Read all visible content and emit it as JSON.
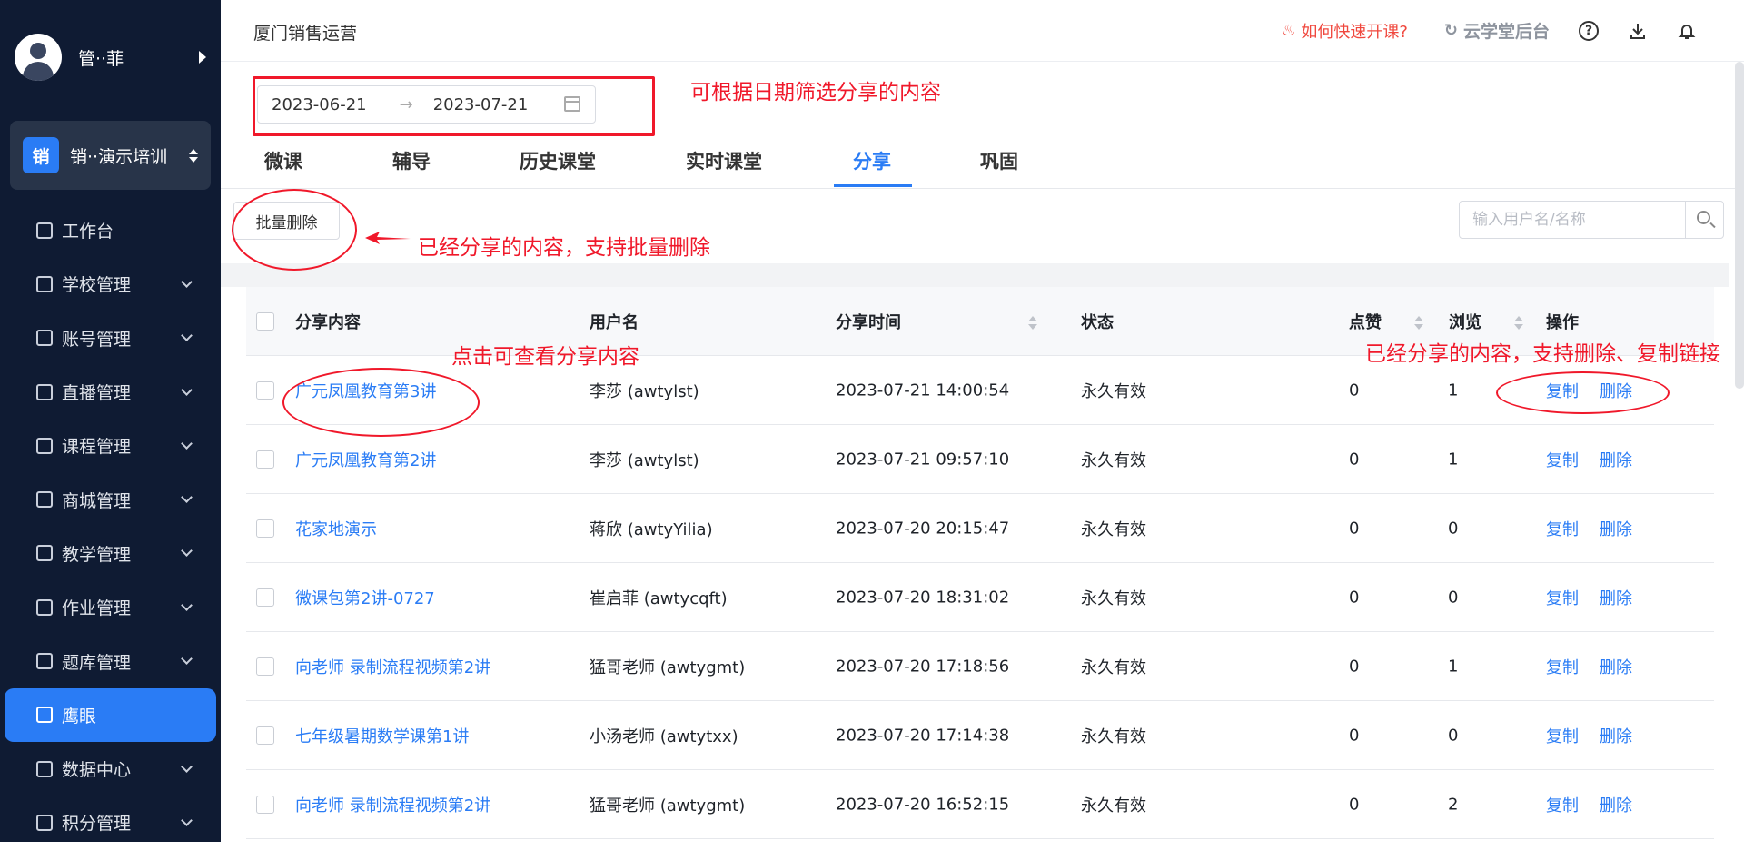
{
  "sidebar": {
    "user_name": "管··菲",
    "org_logo": "销",
    "org_name": "销··演示培训",
    "menu": [
      {
        "label": "工作台",
        "icon": "dashboard-icon",
        "chevron": false
      },
      {
        "label": "学校管理",
        "icon": "school-icon",
        "chevron": true
      },
      {
        "label": "账号管理",
        "icon": "user-icon",
        "chevron": true
      },
      {
        "label": "直播管理",
        "icon": "live-icon",
        "chevron": true
      },
      {
        "label": "课程管理",
        "icon": "course-icon",
        "chevron": true
      },
      {
        "label": "商城管理",
        "icon": "store-icon",
        "chevron": true
      },
      {
        "label": "教学管理",
        "icon": "teach-icon",
        "chevron": true
      },
      {
        "label": "作业管理",
        "icon": "homework-icon",
        "chevron": true
      },
      {
        "label": "题库管理",
        "icon": "question-bank-icon",
        "chevron": true
      },
      {
        "label": "鹰眼",
        "icon": "eagle-eye-icon",
        "chevron": false,
        "active": true
      },
      {
        "label": "数据中心",
        "icon": "data-center-icon",
        "chevron": true
      },
      {
        "label": "积分管理",
        "icon": "star-icon",
        "chevron": true
      }
    ]
  },
  "topbar": {
    "title": "厦门销售运营",
    "quick_start": "如何快速开课?",
    "cloud_admin": "云学堂后台"
  },
  "date_filter": {
    "start": "2023-06-21",
    "arrow": "→",
    "end": "2023-07-21"
  },
  "tabs": [
    "微课",
    "辅导",
    "历史课堂",
    "实时课堂",
    "分享",
    "巩固"
  ],
  "active_tab": "分享",
  "toolbar": {
    "batch_delete": "批量删除",
    "search_placeholder": "输入用户名/名称"
  },
  "table": {
    "headers": {
      "content": "分享内容",
      "user": "用户名",
      "time": "分享时间",
      "status": "状态",
      "likes": "点赞",
      "views": "浏览",
      "actions": "操作"
    },
    "copy_label": "复制",
    "delete_label": "删除",
    "rows": [
      {
        "content": "广元凤凰教育第3讲",
        "user": "李莎 (awtylst)",
        "time": "2023-07-21 14:00:54",
        "status": "永久有效",
        "likes": "0",
        "views": "1"
      },
      {
        "content": "广元凤凰教育第2讲",
        "user": "李莎 (awtylst)",
        "time": "2023-07-21 09:57:10",
        "status": "永久有效",
        "likes": "0",
        "views": "1"
      },
      {
        "content": "花家地演示",
        "user": "蒋欣 (awtyYilia)",
        "time": "2023-07-20 20:15:47",
        "status": "永久有效",
        "likes": "0",
        "views": "0"
      },
      {
        "content": "微课包第2讲-0727",
        "user": "崔启菲 (awtycqft)",
        "time": "2023-07-20 18:31:02",
        "status": "永久有效",
        "likes": "0",
        "views": "0"
      },
      {
        "content": "向老师 录制流程视频第2讲",
        "user": "猛哥老师 (awtygmt)",
        "time": "2023-07-20 17:18:56",
        "status": "永久有效",
        "likes": "0",
        "views": "1"
      },
      {
        "content": "七年级暑期数学课第1讲",
        "user": "小汤老师 (awtytxx)",
        "time": "2023-07-20 17:14:38",
        "status": "永久有效",
        "likes": "0",
        "views": "0"
      },
      {
        "content": "向老师 录制流程视频第2讲",
        "user": "猛哥老师 (awtygmt)",
        "time": "2023-07-20 16:52:15",
        "status": "永久有效",
        "likes": "0",
        "views": "2"
      }
    ]
  },
  "annotations": {
    "date": "可根据日期筛选分享的内容",
    "batch": "已经分享的内容，支持批量删除",
    "view": "点击可查看分享内容",
    "actions": "已经分享的内容，支持删除、复制链接"
  },
  "colors": {
    "primary": "#2a7cf5",
    "sidebar": "#0f1b33",
    "annotation": "#f0182a"
  }
}
